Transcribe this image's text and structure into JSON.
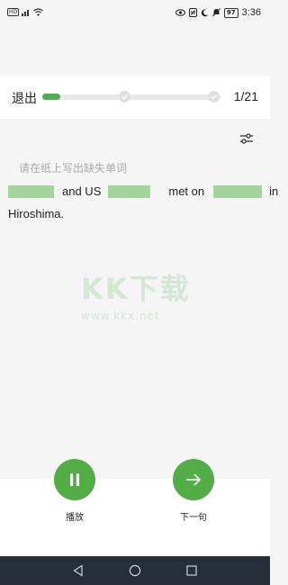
{
  "status_bar": {
    "network_label": "HD",
    "signal_label": "5G",
    "battery": "97",
    "time": "3:36",
    "icons": [
      "eye-icon",
      "nfc-icon",
      "moon-icon",
      "silent-icon",
      "battery-icon"
    ]
  },
  "header": {
    "exit_label": "退出",
    "progress_fraction": 0.1,
    "counter": "1/21",
    "checkpoints": [
      "check-icon",
      "check-icon"
    ]
  },
  "main": {
    "instruction": "请在纸上写出缺失单词",
    "sentence": {
      "line1_words": [
        "and US",
        "met on",
        "in"
      ],
      "line2": "Hiroshima."
    }
  },
  "watermark": {
    "logo": "KK下载",
    "url": "www.kkx.net"
  },
  "controls": {
    "play_label": "播放",
    "next_label": "下一句"
  },
  "colors": {
    "accent": "#52ad47",
    "blank": "#a3d49b",
    "nav_bg": "#252e39"
  }
}
